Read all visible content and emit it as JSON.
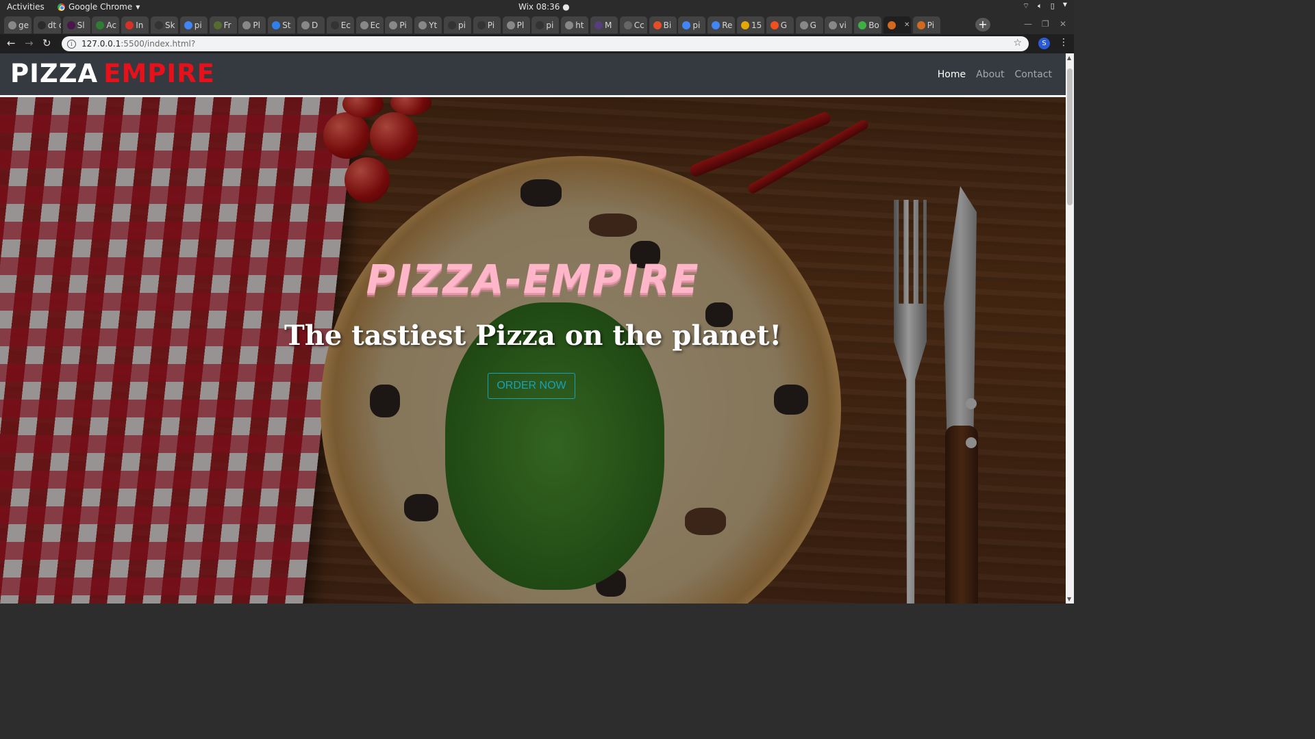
{
  "os": {
    "activities": "Activities",
    "app_name": "Google Chrome",
    "clock": "Wix 08:36 ●"
  },
  "tabs": [
    {
      "label": "ge",
      "icon": "globe-icon",
      "color": "#888888"
    },
    {
      "label": "dt de",
      "icon": "dt-icon",
      "color": "#2b2b2b"
    },
    {
      "label": "Sl",
      "icon": "slack-icon",
      "color": "#4a154b"
    },
    {
      "label": "Ac",
      "icon": "leaf-icon",
      "color": "#2e7d32"
    },
    {
      "label": "In",
      "icon": "gmail-icon",
      "color": "#d93025"
    },
    {
      "label": "Sk",
      "icon": "github-icon",
      "color": "#333333"
    },
    {
      "label": "pi",
      "icon": "google-icon",
      "color": "#4285f4"
    },
    {
      "label": "Fr",
      "icon": "leaf-icon",
      "color": "#556b2f"
    },
    {
      "label": "Pl",
      "icon": "globe-icon",
      "color": "#888888"
    },
    {
      "label": "St",
      "icon": "stackoverflow-icon",
      "color": "#2f80ed"
    },
    {
      "label": "D",
      "icon": "globe-icon",
      "color": "#888888"
    },
    {
      "label": "Ec",
      "icon": "github-icon",
      "color": "#333333"
    },
    {
      "label": "Ec",
      "icon": "globe-icon",
      "color": "#888888"
    },
    {
      "label": "Pi",
      "icon": "globe-icon",
      "color": "#888888"
    },
    {
      "label": "Yt",
      "icon": "globe-icon",
      "color": "#888888"
    },
    {
      "label": "pi",
      "icon": "github-icon",
      "color": "#333333"
    },
    {
      "label": "Pi",
      "icon": "github-icon",
      "color": "#333333"
    },
    {
      "label": "Pl",
      "icon": "globe-icon",
      "color": "#888888"
    },
    {
      "label": "pi",
      "icon": "github-icon",
      "color": "#333333"
    },
    {
      "label": "ht",
      "icon": "globe-icon",
      "color": "#888888"
    },
    {
      "label": "M",
      "icon": "bootstrap-icon",
      "color": "#563d7c"
    },
    {
      "label": "Cc",
      "icon": "wordpress-icon",
      "color": "#666666"
    },
    {
      "label": "Bi",
      "icon": "globe-icon",
      "color": "#e44d26"
    },
    {
      "label": "pi",
      "icon": "google-icon",
      "color": "#4285f4"
    },
    {
      "label": "Re",
      "icon": "google-icon",
      "color": "#4285f4"
    },
    {
      "label": "15",
      "icon": "doc-icon",
      "color": "#e6a700"
    },
    {
      "label": "G",
      "icon": "figma-icon",
      "color": "#f24e1e"
    },
    {
      "label": "G",
      "icon": "globe-icon",
      "color": "#888888"
    },
    {
      "label": "vi",
      "icon": "globe-icon",
      "color": "#888888"
    },
    {
      "label": "Bo",
      "icon": "bootstrap-icon",
      "color": "#3cb043"
    },
    {
      "label": "",
      "icon": "pizza-icon",
      "color": "#d2691e",
      "active": true
    },
    {
      "label": "Pi",
      "icon": "pizza-icon",
      "color": "#d2691e"
    }
  ],
  "address": {
    "host": "127.0.0.1",
    "path": ":5500/index.html?",
    "profile_initial": "S"
  },
  "site": {
    "brand_white": "PIZZA",
    "brand_red": "EMPIRE",
    "nav": [
      "Home",
      "About",
      "Contact"
    ],
    "hero_title": "PIZZA-EMPIRE",
    "hero_subtitle": "The tastiest Pizza on the planet!",
    "cta": "ORDER NOW"
  },
  "colors": {
    "brand_red": "#e8101a",
    "hero_title": "#ffb6c9",
    "cta": "#17a2b8",
    "navbar": "#343a40"
  }
}
